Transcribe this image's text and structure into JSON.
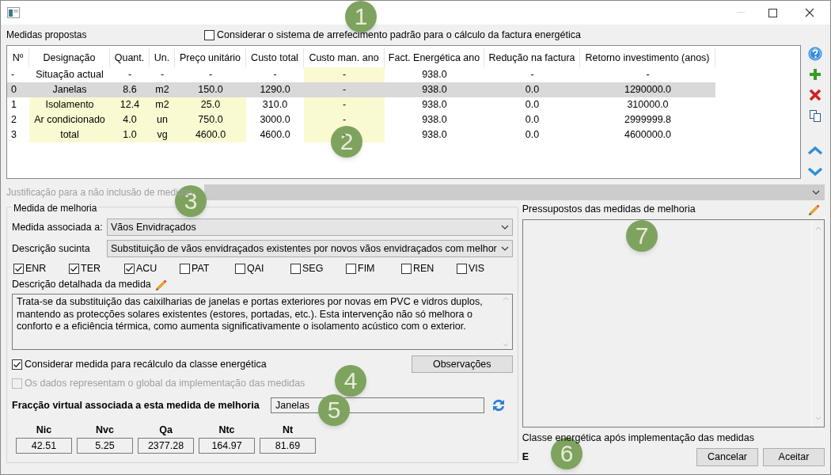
{
  "header": {
    "label": "Medidas propostas",
    "cooling_checkbox": {
      "label": "Considerar o sistema de arrefecimento padrão para o cálculo da factura energética",
      "checked": false
    }
  },
  "table": {
    "columns": [
      "Nº",
      "Designação",
      "Quant.",
      "Un.",
      "Preço unitário",
      "Custo total",
      "Custo man. ano",
      "Fact. Energética ano",
      "Redução na factura",
      "Retorno investimento (anos)"
    ],
    "rows": [
      {
        "cells": [
          "-",
          "Situação actual",
          "-",
          "-",
          "-",
          "-",
          "-",
          "938.0",
          "-",
          "-"
        ],
        "highlighted": [
          false,
          false,
          false,
          false,
          false,
          false,
          true,
          false,
          false,
          false
        ],
        "selected": false
      },
      {
        "cells": [
          "0",
          "Janelas",
          "8.6",
          "m2",
          "150.0",
          "1290.0",
          "-",
          "938.0",
          "0.0",
          "1290000.0"
        ],
        "highlighted": [
          false,
          false,
          false,
          false,
          false,
          false,
          false,
          false,
          false,
          false
        ],
        "selected": true
      },
      {
        "cells": [
          "1",
          "Isolamento",
          "12.4",
          "m2",
          "25.0",
          "310.0",
          "-",
          "938.0",
          "0.0",
          "310000.0"
        ],
        "highlighted": [
          false,
          true,
          true,
          true,
          true,
          false,
          true,
          false,
          false,
          false
        ],
        "selected": false
      },
      {
        "cells": [
          "2",
          "Ar condicionado",
          "4.0",
          "un",
          "750.0",
          "3000.0",
          "-",
          "938.0",
          "0.0",
          "2999999.8"
        ],
        "highlighted": [
          false,
          true,
          true,
          true,
          true,
          false,
          true,
          false,
          false,
          false
        ],
        "selected": false
      },
      {
        "cells": [
          "3",
          "total",
          "1.0",
          "vg",
          "4600.0",
          "4600.0",
          "-",
          "938.0",
          "0.0",
          "4600000.0"
        ],
        "highlighted": [
          false,
          true,
          true,
          true,
          true,
          false,
          true,
          false,
          false,
          false
        ],
        "selected": false
      }
    ]
  },
  "justification": {
    "label": "Justificação para a não inclusão de medidas",
    "disabled": true
  },
  "improvement": {
    "title": "Medida de melhoria",
    "associated": {
      "label": "Medida associada a:",
      "value": "Vãos Envidraçados"
    },
    "summary": {
      "label": "Descrição sucinta",
      "value": "Substituição de vãos envidraçados existentes por novos vãos envidraçados com melhor"
    },
    "tags": [
      {
        "label": "ENR",
        "checked": true
      },
      {
        "label": "TER",
        "checked": true
      },
      {
        "label": "ACU",
        "checked": true
      },
      {
        "label": "PAT",
        "checked": false
      },
      {
        "label": "QAI",
        "checked": false
      },
      {
        "label": "SEG",
        "checked": false
      },
      {
        "label": "FIM",
        "checked": false
      },
      {
        "label": "REN",
        "checked": false
      },
      {
        "label": "VIS",
        "checked": false
      }
    ],
    "detail": {
      "label": "Descrição detalhada da medida",
      "text": "Trata-se da substituição das caixilharias de janelas e portas exteriores por novas em PVC e vidros duplos, mantendo as protecções solares existentes (estores, portadas, etc.). Esta intervenção não só melhora o conforto e a eficiência térmica, como aumenta significativamente o isolamento acústico com o exterior."
    },
    "recalc": {
      "label": "Considerar medida para recálculo da classe energética",
      "checked": true,
      "disabled": false
    },
    "global": {
      "label": "Os dados representam o global da implementação das medidas",
      "checked": false,
      "disabled": true
    },
    "observations_button": "Observações",
    "virtual_fraction": {
      "label": "Fracção virtual associada a esta medida de melhoria",
      "value": "Janelas"
    },
    "indicators": [
      {
        "label": "Nic",
        "value": "42.51"
      },
      {
        "label": "Nvc",
        "value": "5.25"
      },
      {
        "label": "Qa",
        "value": "2377.28"
      },
      {
        "label": "Ntc",
        "value": "164.97"
      },
      {
        "label": "Nt",
        "value": "81.69"
      }
    ]
  },
  "assumptions": {
    "label": "Pressupostos das medidas de melhoria"
  },
  "energy_class": {
    "label": "Classe energética após implementação das medidas",
    "value": "E"
  },
  "buttons": [
    "Cancelar",
    "Aceitar"
  ],
  "callouts": [
    "1",
    "2",
    "3",
    "4",
    "5",
    "6",
    "7"
  ]
}
